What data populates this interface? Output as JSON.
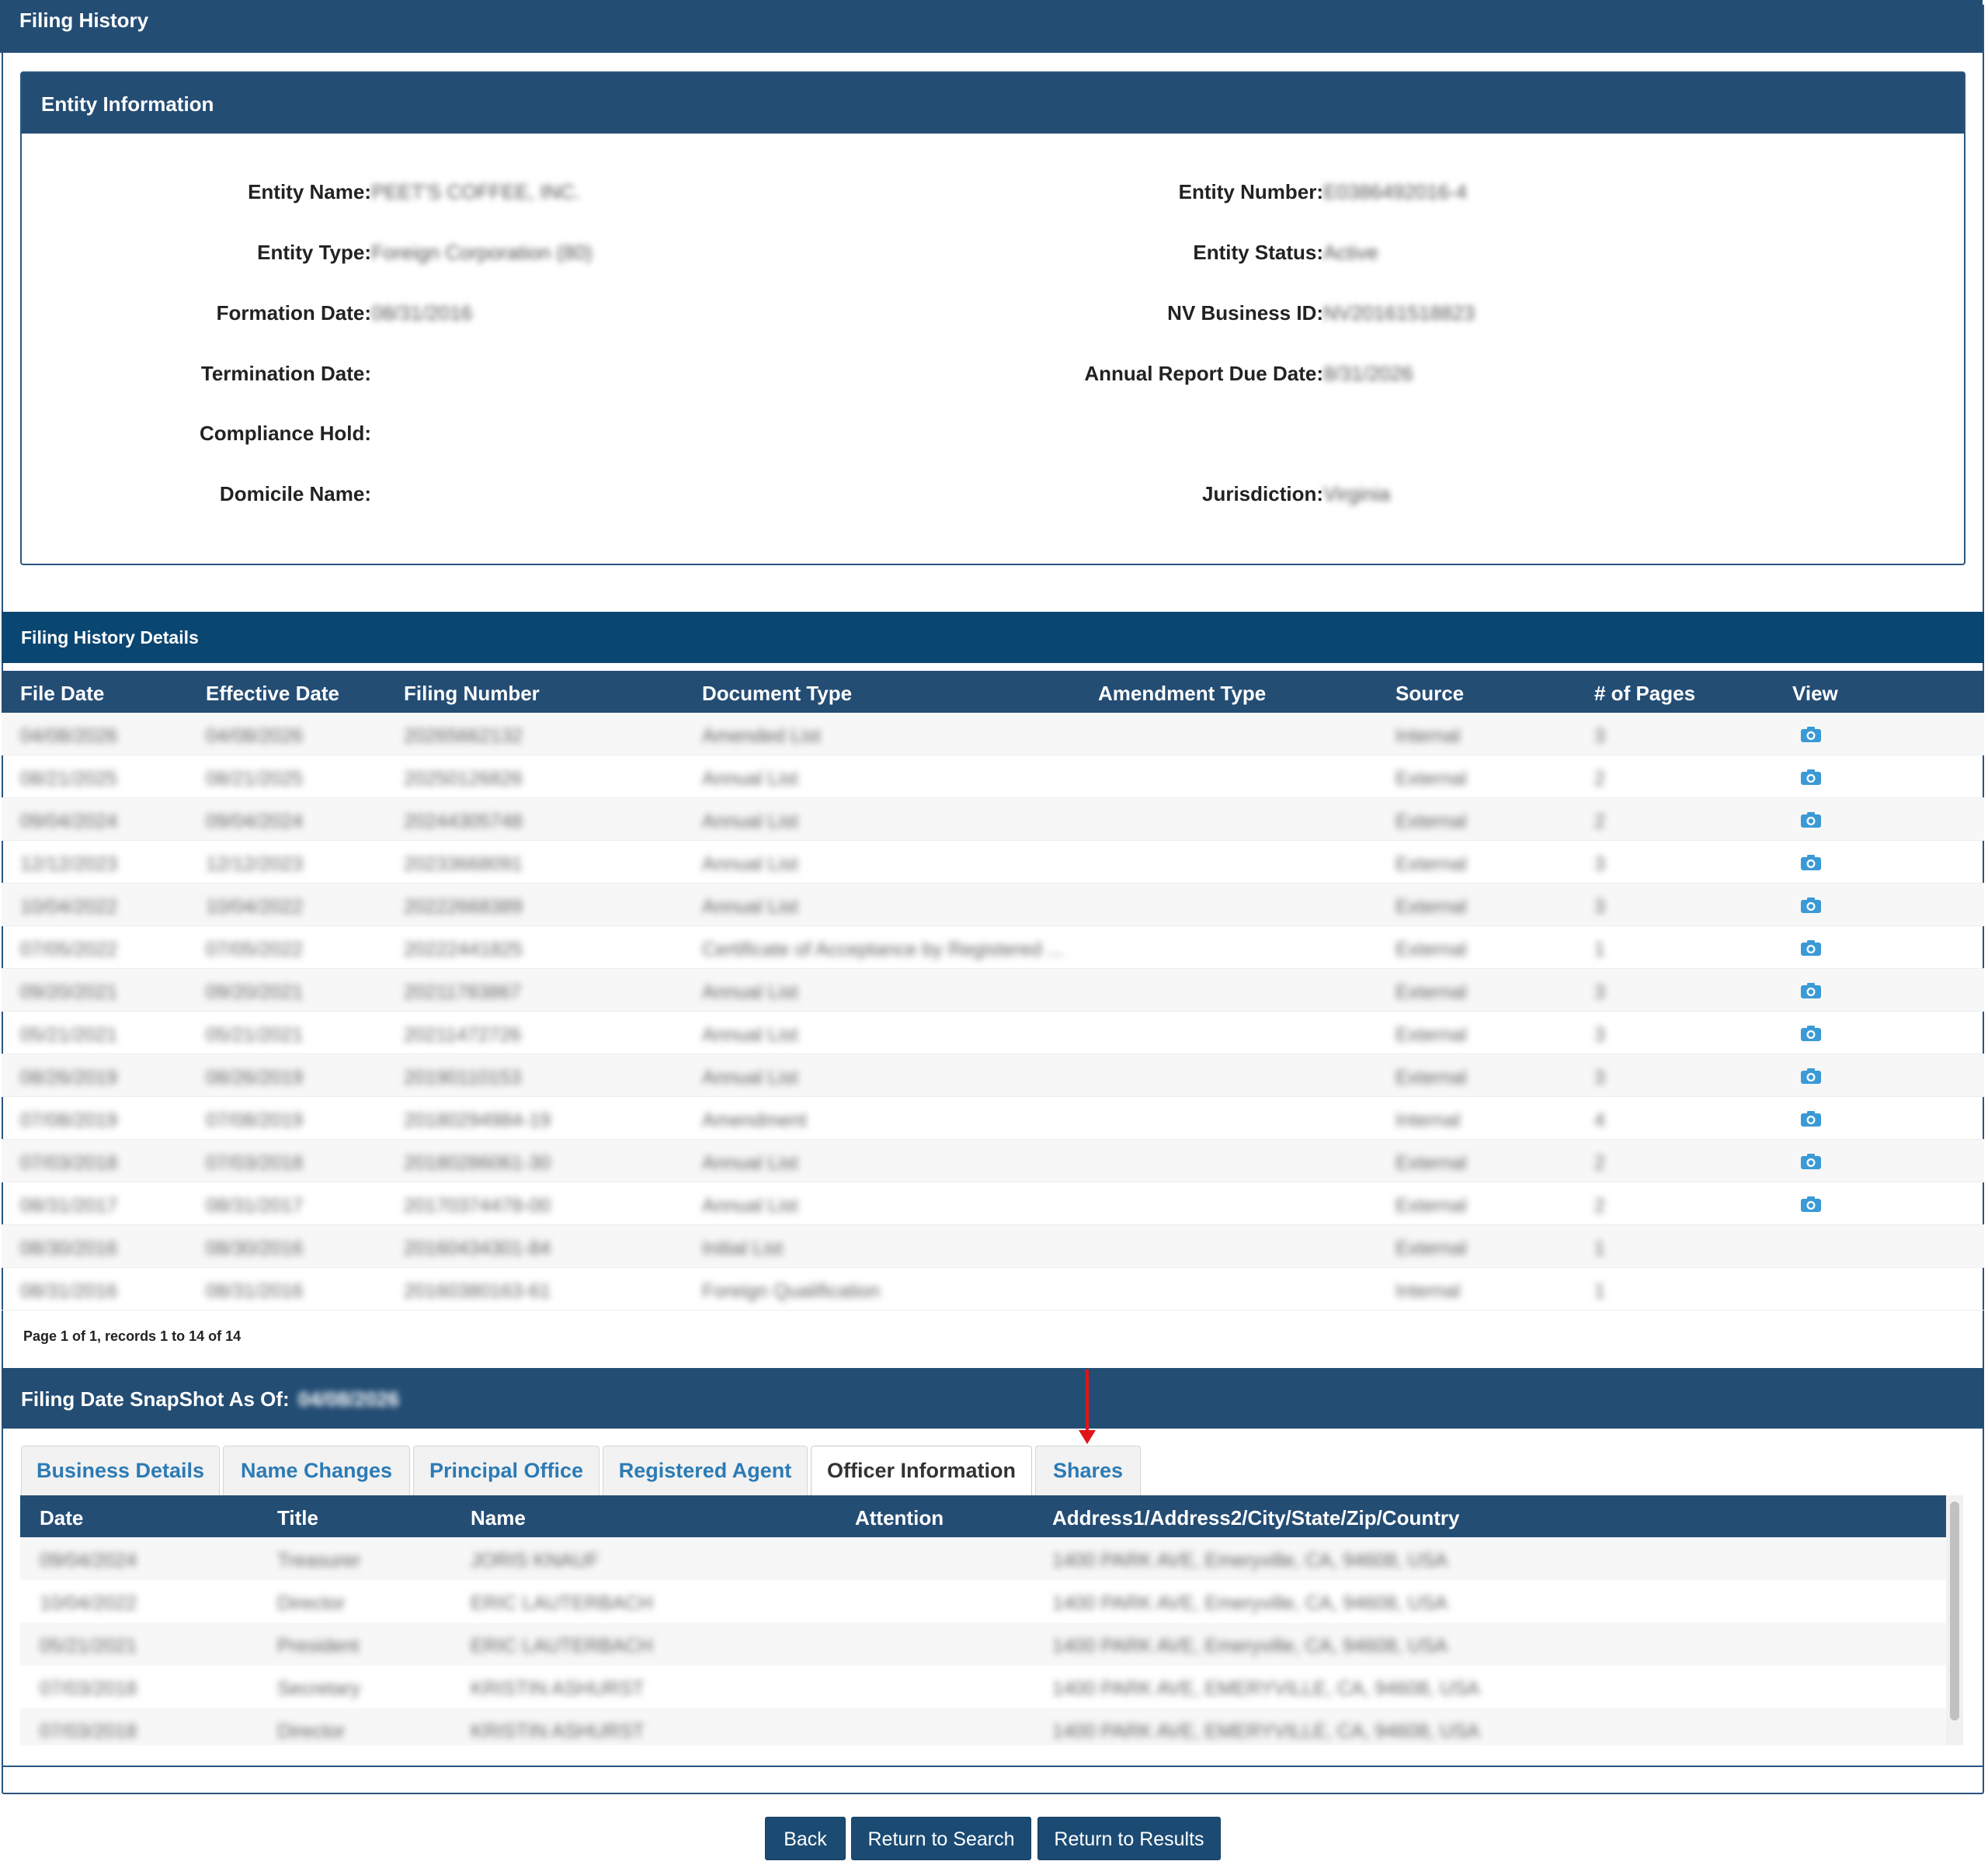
{
  "page": {
    "title": "Filing History"
  },
  "entity": {
    "header": "Entity Information",
    "left": [
      {
        "label": "Entity Name:",
        "value": "PEET'S COFFEE, INC."
      },
      {
        "label": "Entity Type:",
        "value": "Foreign Corporation (80)"
      },
      {
        "label": "Formation Date:",
        "value": "08/31/2016"
      },
      {
        "label": "Termination Date:",
        "value": ""
      },
      {
        "label": "Compliance Hold:",
        "value": ""
      },
      {
        "label": "Domicile Name:",
        "value": ""
      }
    ],
    "right": [
      {
        "label": "Entity Number:",
        "value": "E0386492016-4"
      },
      {
        "label": "Entity Status:",
        "value": "Active"
      },
      {
        "label": "NV Business ID:",
        "value": "NV20161518823"
      },
      {
        "label": "Annual Report Due Date:",
        "value": "8/31/2026"
      },
      {
        "label": "Jurisdiction:",
        "value": "Virginia"
      }
    ]
  },
  "filing_history": {
    "header": "Filing History Details",
    "columns": [
      "File Date",
      "Effective Date",
      "Filing Number",
      "Document Type",
      "Amendment Type",
      "Source",
      "# of Pages",
      "View"
    ],
    "rows": [
      [
        "04/08/2026",
        "04/08/2026",
        "20265662132",
        "Amended List",
        "",
        "Internal",
        "3",
        true
      ],
      [
        "08/21/2025",
        "08/21/2025",
        "20250126826",
        "Annual List",
        "",
        "External",
        "2",
        true
      ],
      [
        "09/04/2024",
        "09/04/2024",
        "20244305748",
        "Annual List",
        "",
        "External",
        "2",
        true
      ],
      [
        "12/12/2023",
        "12/12/2023",
        "20233668091",
        "Annual List",
        "",
        "External",
        "3",
        true
      ],
      [
        "10/04/2022",
        "10/04/2022",
        "20222668389",
        "Annual List",
        "",
        "External",
        "3",
        true
      ],
      [
        "07/05/2022",
        "07/05/2022",
        "20222441825",
        "Certificate of Acceptance by Registered ...",
        "",
        "External",
        "1",
        true
      ],
      [
        "09/20/2021",
        "09/20/2021",
        "20211783867",
        "Annual List",
        "",
        "External",
        "3",
        true
      ],
      [
        "05/21/2021",
        "05/21/2021",
        "20211472726",
        "Annual List",
        "",
        "External",
        "3",
        true
      ],
      [
        "08/26/2019",
        "08/26/2019",
        "20190110153",
        "Annual List",
        "",
        "External",
        "3",
        true
      ],
      [
        "07/08/2019",
        "07/08/2019",
        "20180294984-19",
        "Amendment",
        "",
        "Internal",
        "4",
        true
      ],
      [
        "07/03/2018",
        "07/03/2018",
        "20180286061-30",
        "Annual List",
        "",
        "External",
        "2",
        true
      ],
      [
        "08/31/2017",
        "08/31/2017",
        "20170374478-00",
        "Annual List",
        "",
        "External",
        "2",
        true
      ],
      [
        "08/30/2016",
        "08/30/2016",
        "20160434301-84",
        "Initial List",
        "",
        "External",
        "1",
        false
      ],
      [
        "08/31/2016",
        "08/31/2016",
        "20160380163-61",
        "Foreign Qualification",
        "",
        "Internal",
        "1",
        false
      ]
    ],
    "pager": "Page 1 of 1, records 1 to 14 of 14",
    "view_icon": "camera-icon"
  },
  "snapshot": {
    "label": "Filing Date SnapShot As Of:",
    "date": "04/08/2026",
    "tabs": [
      "Business Details",
      "Name Changes",
      "Principal Office",
      "Registered Agent",
      "Officer Information",
      "Shares"
    ],
    "active_tab": "Officer Information",
    "officer_columns": [
      "Date",
      "Title",
      "Name",
      "Attention",
      "Address1/Address2/City/State/Zip/Country"
    ],
    "officers": [
      [
        "09/04/2024",
        "Treasurer",
        "JORIS KNAUF",
        "",
        "1400 PARK AVE, Emeryville, CA, 94608, USA"
      ],
      [
        "10/04/2022",
        "Director",
        "ERIC LAUTERBACH",
        "",
        "1400 PARK AVE, Emeryville, CA, 94608, USA"
      ],
      [
        "05/21/2021",
        "President",
        "ERIC LAUTERBACH",
        "",
        "1400 PARK AVE, Emeryville, CA, 94608, USA"
      ],
      [
        "07/03/2018",
        "Secretary",
        "KRISTIN ASHURST",
        "",
        "1400 PARK AVE, EMERYVILLE, CA, 94608, USA"
      ],
      [
        "07/03/2018",
        "Director",
        "KRISTIN ASHURST",
        "",
        "1400 PARK AVE, EMERYVILLE, CA, 94608, USA"
      ]
    ]
  },
  "buttons": {
    "back": "Back",
    "return_search": "Return to Search",
    "return_results": "Return to Results"
  },
  "colors": {
    "header_bg": "#244d74",
    "link": "#2c7bb5",
    "icon": "#3a9ad6",
    "arrow": "#e0141a"
  }
}
